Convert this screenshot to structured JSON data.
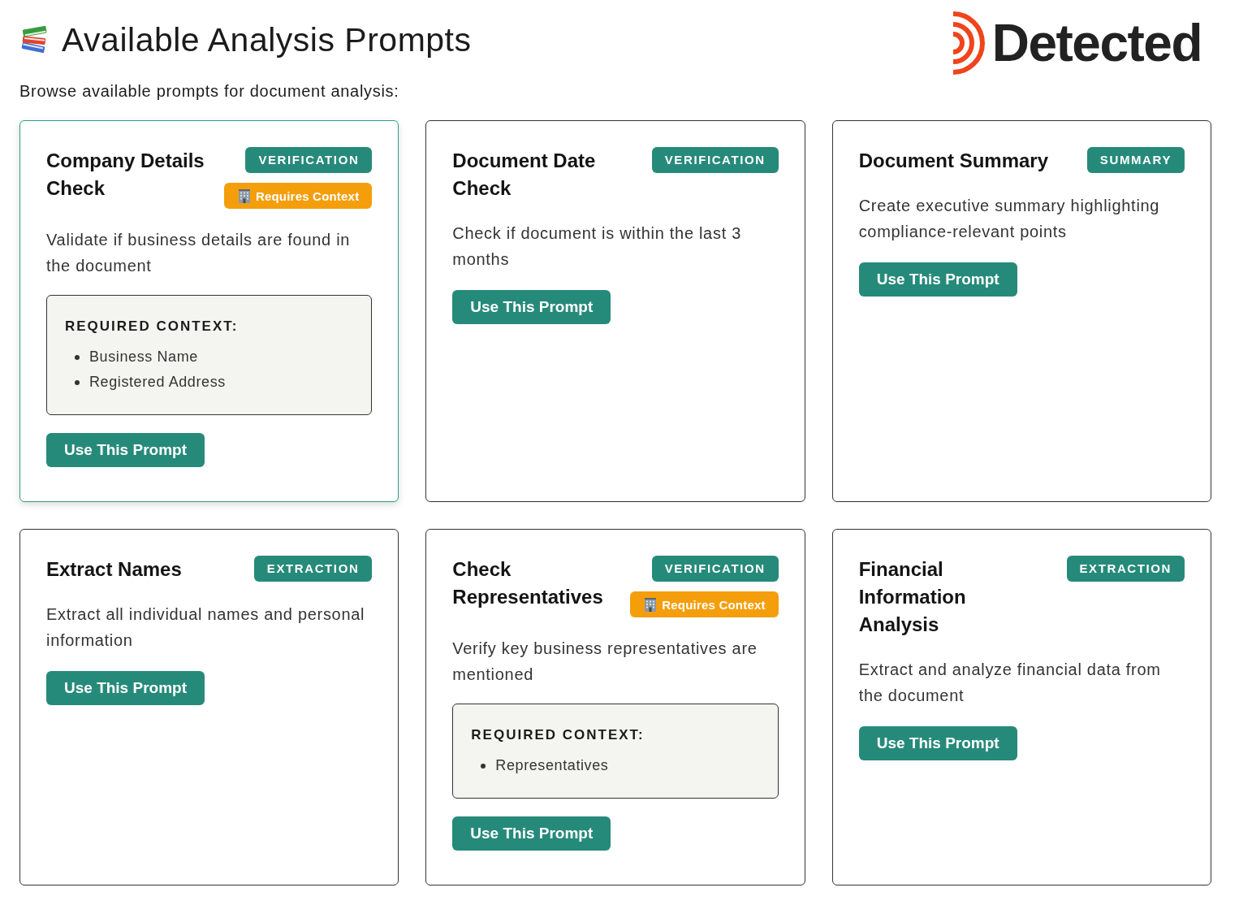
{
  "header": {
    "title": "Available Analysis Prompts",
    "logo_text": "Detected"
  },
  "intro": "Browse available prompts for document analysis:",
  "prompts": [
    {
      "title": "Company Details Check",
      "category": "VERIFICATION",
      "context_badge": "Requires Context",
      "description": "Validate if business details are found in the document",
      "required_context": {
        "heading": "REQUIRED CONTEXT:",
        "items": [
          "Business Name",
          "Registered Address"
        ]
      },
      "button": "Use This Prompt",
      "selected": true
    },
    {
      "title": "Document Date Check",
      "category": "VERIFICATION",
      "description": "Check if document is within the last 3 months",
      "button": "Use This Prompt",
      "selected": false
    },
    {
      "title": "Document Summary",
      "category": "SUMMARY",
      "description": "Create executive summary highlighting compliance-relevant points",
      "button": "Use This Prompt",
      "selected": false
    },
    {
      "title": "Extract Names",
      "category": "EXTRACTION",
      "description": "Extract all individual names and personal information",
      "button": "Use This Prompt",
      "selected": false
    },
    {
      "title": "Check Representatives",
      "category": "VERIFICATION",
      "context_badge": "Requires Context",
      "description": "Verify key business representatives are mentioned",
      "required_context": {
        "heading": "REQUIRED CONTEXT:",
        "items": [
          "Representatives"
        ]
      },
      "button": "Use This Prompt",
      "selected": false
    },
    {
      "title": "Financial Information Analysis",
      "category": "EXTRACTION",
      "description": "Extract and analyze financial data from the document",
      "button": "Use This Prompt",
      "selected": false
    }
  ]
}
